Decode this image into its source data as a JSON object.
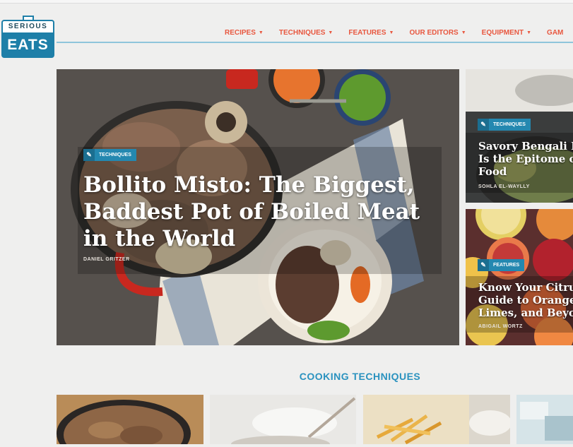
{
  "logo": {
    "top": "SERIOUS",
    "bottom": "EATS"
  },
  "nav": {
    "items": [
      {
        "label": "RECIPES"
      },
      {
        "label": "TECHNIQUES"
      },
      {
        "label": "FEATURES"
      },
      {
        "label": "OUR EDITORS"
      },
      {
        "label": "EQUIPMENT"
      },
      {
        "label": "GAM"
      }
    ]
  },
  "hero": {
    "badge": "TECHNIQUES",
    "title": "Bollito Misto: The Biggest, Baddest Pot of Boiled Meat in the World",
    "byline": "DANIEL GRITZER"
  },
  "side_tiles": [
    {
      "badge": "TECHNIQUES",
      "title_lines": [
        "Savory Bengali R",
        "Is the Epitome of",
        "Food"
      ],
      "byline": "SOHLA EL-WAYLLY"
    },
    {
      "badge": "FEATURES",
      "title_lines": [
        "Know Your Citru",
        "Guide to Oranges",
        "Limes, and Beyon"
      ],
      "byline": "ABIGAIL WORTZ"
    }
  ],
  "section": {
    "title": "COOKING TECHNIQUES"
  },
  "colors": {
    "accent": "#e8573f",
    "brand": "#1e7fa8",
    "section": "#2a92bf"
  }
}
